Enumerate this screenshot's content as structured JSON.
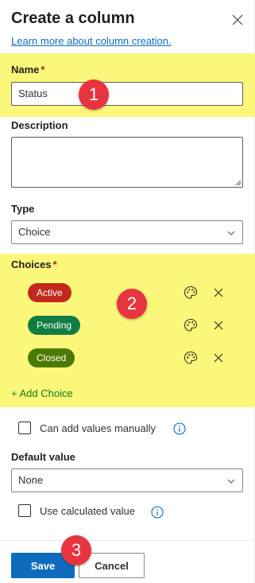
{
  "panel": {
    "title": "Create a column",
    "learn_link": "Learn more about column creation."
  },
  "name_field": {
    "label": "Name",
    "required_mark": "*",
    "value": "Status"
  },
  "description_field": {
    "label": "Description",
    "value": ""
  },
  "type_field": {
    "label": "Type",
    "selected": "Choice"
  },
  "choices_section": {
    "label": "Choices",
    "required_mark": "*",
    "items": [
      {
        "label": "Active",
        "color": "#c4281c"
      },
      {
        "label": "Pending",
        "color": "#107c41"
      },
      {
        "label": "Closed",
        "color": "#4c7a00"
      }
    ],
    "add_label": "+ Add Choice"
  },
  "options": {
    "manual_values_label": "Can add values manually",
    "manual_values_checked": false,
    "default_value_label": "Default value",
    "default_value_selected": "None",
    "calculated_label": "Use calculated value",
    "calculated_checked": false
  },
  "footer": {
    "save_label": "Save",
    "cancel_label": "Cancel"
  },
  "annotations": {
    "steps": [
      "1",
      "2",
      "3"
    ],
    "highlight_color": "#fbf77a",
    "badge_color": "#e8343f"
  },
  "icons": {
    "close": "close-icon",
    "chevron": "chevron-down-icon",
    "palette": "palette-icon",
    "remove": "remove-icon",
    "info": "info-icon"
  }
}
